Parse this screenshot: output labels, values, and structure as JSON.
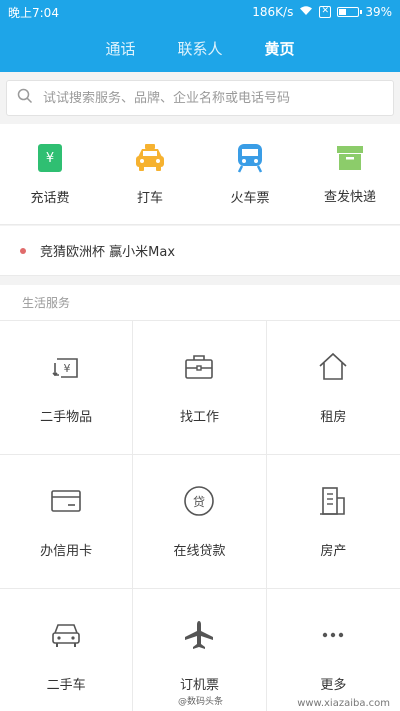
{
  "status": {
    "time": "晚上7:04",
    "speed": "186K/s",
    "battery": "39%",
    "battery_level": 0.39
  },
  "tabs": [
    {
      "label": "通话",
      "active": false
    },
    {
      "label": "联系人",
      "active": false
    },
    {
      "label": "黄页",
      "active": true
    }
  ],
  "search": {
    "placeholder": "试试搜索服务、品牌、企业名称或电话号码"
  },
  "quick": [
    {
      "label": "充话费",
      "icon": "phone-bill-icon",
      "color": "#2fbf72"
    },
    {
      "label": "打车",
      "icon": "taxi-icon",
      "color": "#f6b230"
    },
    {
      "label": "火车票",
      "icon": "train-icon",
      "color": "#3a9de6"
    },
    {
      "label": "查发快递",
      "icon": "express-box-icon",
      "color": "#8ccc6a"
    }
  ],
  "notice": {
    "text": "竞猜欧洲杯 赢小米Max"
  },
  "section": {
    "title": "生活服务",
    "items": [
      {
        "label": "二手物品",
        "icon": "secondhand-goods-icon"
      },
      {
        "label": "找工作",
        "icon": "briefcase-icon"
      },
      {
        "label": "租房",
        "icon": "house-icon"
      },
      {
        "label": "办信用卡",
        "icon": "credit-card-icon"
      },
      {
        "label": "在线贷款",
        "icon": "loan-icon"
      },
      {
        "label": "房产",
        "icon": "building-icon"
      },
      {
        "label": "二手车",
        "icon": "car-icon"
      },
      {
        "label": "订机票",
        "icon": "airplane-icon"
      },
      {
        "label": "更多",
        "icon": "more-dots-icon"
      }
    ]
  },
  "watermark": {
    "weibo": "@数码头条",
    "site": "www.xiazaiba.com"
  }
}
